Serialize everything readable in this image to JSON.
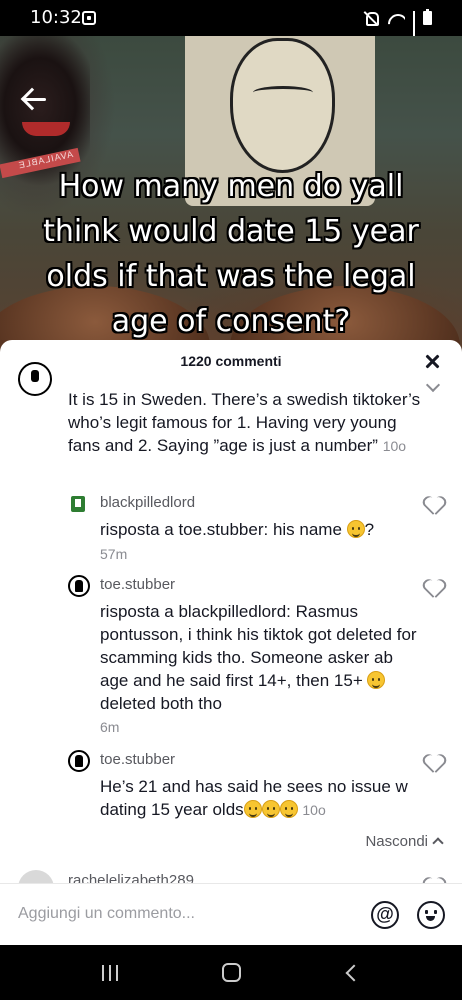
{
  "status_bar": {
    "time": "10:32"
  },
  "video": {
    "caption": "How many men do yall think would date 15 year olds if that was the legal age of consent?",
    "banner_text": "AVAILABLE"
  },
  "comments_sheet": {
    "count_label": "1220 commenti",
    "comments": [
      {
        "text": "It is 15 in Sweden. There’s a swedish tiktoker’s who’s legit famous for 1. Having very young fans and 2. Saying ”age is just a number”",
        "time": "10o"
      },
      {
        "username": "blackpilledlord",
        "reply_prefix": "risposta a ",
        "reply_to": "toe.stubber",
        "text": ": his name ",
        "text_after": "?",
        "time": "57m"
      },
      {
        "username": "toe.stubber",
        "reply_prefix": "risposta a ",
        "reply_to": "blackpilledlord",
        "text": ": Rasmus pontusson, i think his tiktok got deleted for scamming kids tho. Someone asker ab age and he said first 14+, then 15+ ",
        "text_after": " deleted both tho",
        "time": "6m"
      },
      {
        "username": "toe.stubber",
        "text": "He’s 21 and has said he sees no issue w dating 15 year olds",
        "time": "10o"
      }
    ],
    "hide_label": "Nascondi",
    "next_username": "rachelelizabeth289"
  },
  "input_bar": {
    "placeholder": "Aggiungi un commento...",
    "mention_symbol": "@"
  },
  "icons": [
    "back-arrow-icon",
    "close-icon",
    "heart-icon",
    "chevron-down-icon",
    "chevron-up-icon",
    "at-icon",
    "emoji-icon"
  ]
}
